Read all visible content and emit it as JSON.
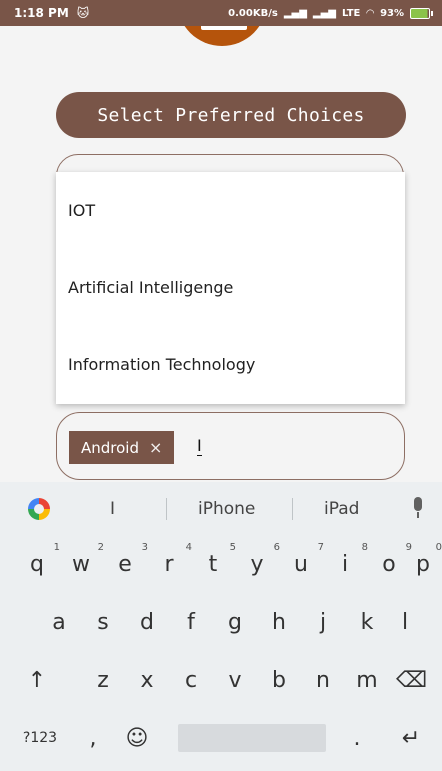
{
  "status_bar": {
    "time": "1:18 PM",
    "network": "0.00KB/s",
    "volte": "LTE",
    "battery": "93%",
    "icons": [
      "cat-icon",
      "signal-icon",
      "signal-icon",
      "wifi-icon",
      "battery-icon"
    ]
  },
  "title": "Select Preferred Choices",
  "field_top_text": "...",
  "dropdown": {
    "items": [
      "IOT",
      "Artificial Intelligenge",
      "Information Technology"
    ]
  },
  "chip_input": {
    "chip_label": "Android",
    "chip_close": "×",
    "typed_text": "I"
  },
  "keyboard": {
    "suggestions": [
      "I",
      "iPhone",
      "iPad"
    ],
    "row1": [
      [
        "q",
        "1"
      ],
      [
        "w",
        "2"
      ],
      [
        "e",
        "3"
      ],
      [
        "r",
        "4"
      ],
      [
        "t",
        "5"
      ],
      [
        "y",
        "6"
      ],
      [
        "u",
        "7"
      ],
      [
        "i",
        "8"
      ],
      [
        "o",
        "9"
      ],
      [
        "p",
        "0"
      ]
    ],
    "row2": [
      "a",
      "s",
      "d",
      "f",
      "g",
      "h",
      "j",
      "k",
      "l"
    ],
    "row3": [
      "z",
      "x",
      "c",
      "v",
      "b",
      "n",
      "m"
    ],
    "shift": "↑",
    "backspace": "⌫",
    "symbols": "?123",
    "comma": ",",
    "emoji": "☺",
    "period": ".",
    "enter": "↵"
  },
  "colors": {
    "primary": "#795548",
    "logo": "#b5540c"
  }
}
